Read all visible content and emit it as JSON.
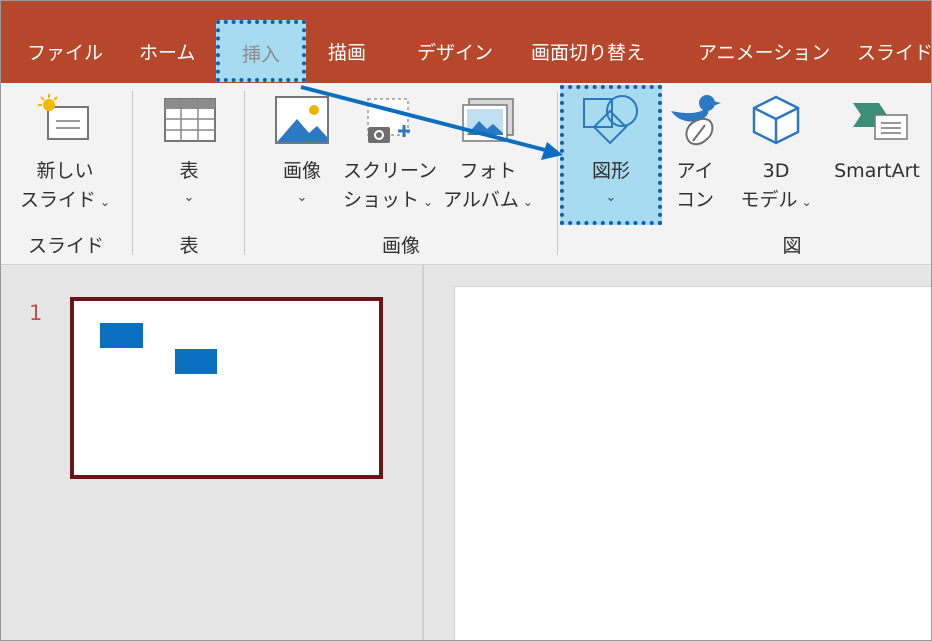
{
  "tabs": [
    {
      "label": "ファイル"
    },
    {
      "label": "ホーム"
    },
    {
      "label": "挿入",
      "active": true
    },
    {
      "label": "描画"
    },
    {
      "label": "デザイン"
    },
    {
      "label": "画面切り替え"
    },
    {
      "label": "アニメーション"
    },
    {
      "label": "スライド"
    }
  ],
  "ribbon": {
    "new_slide": {
      "line1": "新しい",
      "line2": "スライド"
    },
    "table": {
      "label": "表"
    },
    "image": {
      "label": "画像"
    },
    "screenshot": {
      "line1": "スクリーン",
      "line2": "ショット"
    },
    "photo_album": {
      "line1": "フォト",
      "line2": "アルバム"
    },
    "shapes": {
      "label": "図形"
    },
    "icons": {
      "line1": "アイ",
      "line2": "コン"
    },
    "model3d": {
      "line1": "3D",
      "line2": "モデル"
    },
    "smartart": {
      "label": "SmartArt"
    },
    "chevron": "⌄",
    "groups": {
      "slides": "スライド",
      "tables": "表",
      "images": "画像",
      "illustrations": "図"
    }
  },
  "slides_pane": {
    "slide_number": "1"
  },
  "colors": {
    "tab_bar": "#b7472a",
    "highlight_fill": "#a7dcf0",
    "highlight_border": "#0b62b5",
    "slide_rect": "#0b6fc1",
    "thumb_border": "#6e1317"
  }
}
